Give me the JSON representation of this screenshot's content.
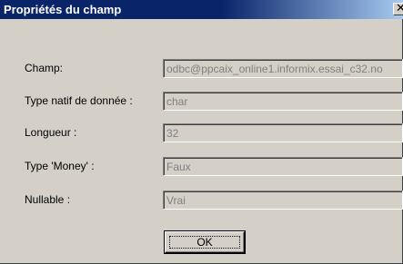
{
  "window": {
    "title": "Propriétés du champ",
    "close_symbol": "✕"
  },
  "fields": [
    {
      "label": "Champ:",
      "value": "odbc@ppcaix_online1.informix.essai_c32.no"
    },
    {
      "label": "Type natif de donnée :",
      "value": "char"
    },
    {
      "label": "Longueur :",
      "value": "32"
    },
    {
      "label": "Type 'Money' :",
      "value": "Faux"
    },
    {
      "label": "Nullable :",
      "value": "Vrai"
    }
  ],
  "buttons": {
    "ok_label": "OK"
  },
  "colors": {
    "title_bar_start": "#0a246a",
    "title_bar_end": "#a6caf0",
    "dialog_face": "#d4d0c8",
    "disabled_text": "#808080"
  }
}
